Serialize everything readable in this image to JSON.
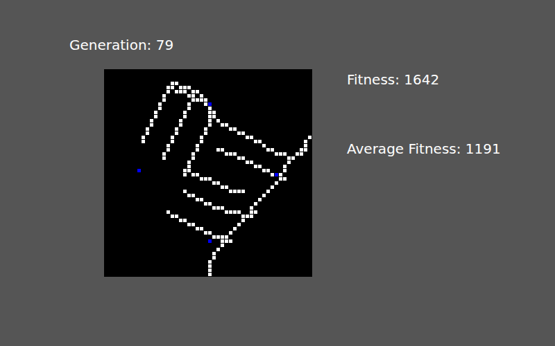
{
  "generation_label": "Generation: 79",
  "fitness_label": "Fitness: 1642",
  "average_fitness_label": "Average Fitness: 1191",
  "board": {
    "grid_size": 50,
    "branches": [
      [
        [
          25,
          49
        ],
        [
          25,
          46
        ],
        [
          27,
          43
        ],
        [
          29,
          40
        ],
        [
          33,
          36
        ],
        [
          37,
          31
        ],
        [
          41,
          27
        ],
        [
          44,
          22
        ],
        [
          47,
          19
        ],
        [
          49,
          16
        ]
      ],
      [
        [
          15,
          4
        ],
        [
          18,
          5
        ],
        [
          21,
          6
        ],
        [
          25,
          9
        ],
        [
          27,
          12
        ],
        [
          30,
          14
        ],
        [
          34,
          16
        ],
        [
          38,
          18
        ],
        [
          41,
          20
        ],
        [
          45,
          21
        ],
        [
          48,
          19
        ]
      ],
      [
        [
          16,
          3
        ],
        [
          19,
          4
        ],
        [
          22,
          5
        ],
        [
          25,
          8
        ]
      ],
      [
        [
          27,
          19
        ],
        [
          30,
          20
        ],
        [
          34,
          22
        ],
        [
          38,
          24
        ],
        [
          41,
          25
        ],
        [
          43,
          26
        ]
      ],
      [
        [
          20,
          24
        ],
        [
          23,
          26
        ],
        [
          27,
          27
        ],
        [
          30,
          29
        ],
        [
          33,
          29
        ]
      ],
      [
        [
          19,
          29
        ],
        [
          22,
          31
        ],
        [
          26,
          33
        ],
        [
          30,
          34
        ],
        [
          34,
          35
        ],
        [
          36,
          34
        ]
      ],
      [
        [
          15,
          34
        ],
        [
          18,
          36
        ],
        [
          22,
          38
        ],
        [
          26,
          40
        ],
        [
          30,
          41
        ]
      ],
      [
        [
          9,
          17
        ],
        [
          11,
          13
        ],
        [
          13,
          9
        ],
        [
          15,
          4
        ]
      ],
      [
        [
          14,
          21
        ],
        [
          16,
          17
        ],
        [
          18,
          13
        ],
        [
          20,
          9
        ],
        [
          21,
          6
        ]
      ],
      [
        [
          19,
          25
        ],
        [
          21,
          21
        ],
        [
          23,
          16
        ],
        [
          25,
          13
        ],
        [
          25,
          9
        ]
      ]
    ],
    "blue_cells": [
      [
        25,
        8
      ],
      [
        41,
        25
      ],
      [
        25,
        41
      ],
      [
        8,
        24
      ]
    ]
  }
}
